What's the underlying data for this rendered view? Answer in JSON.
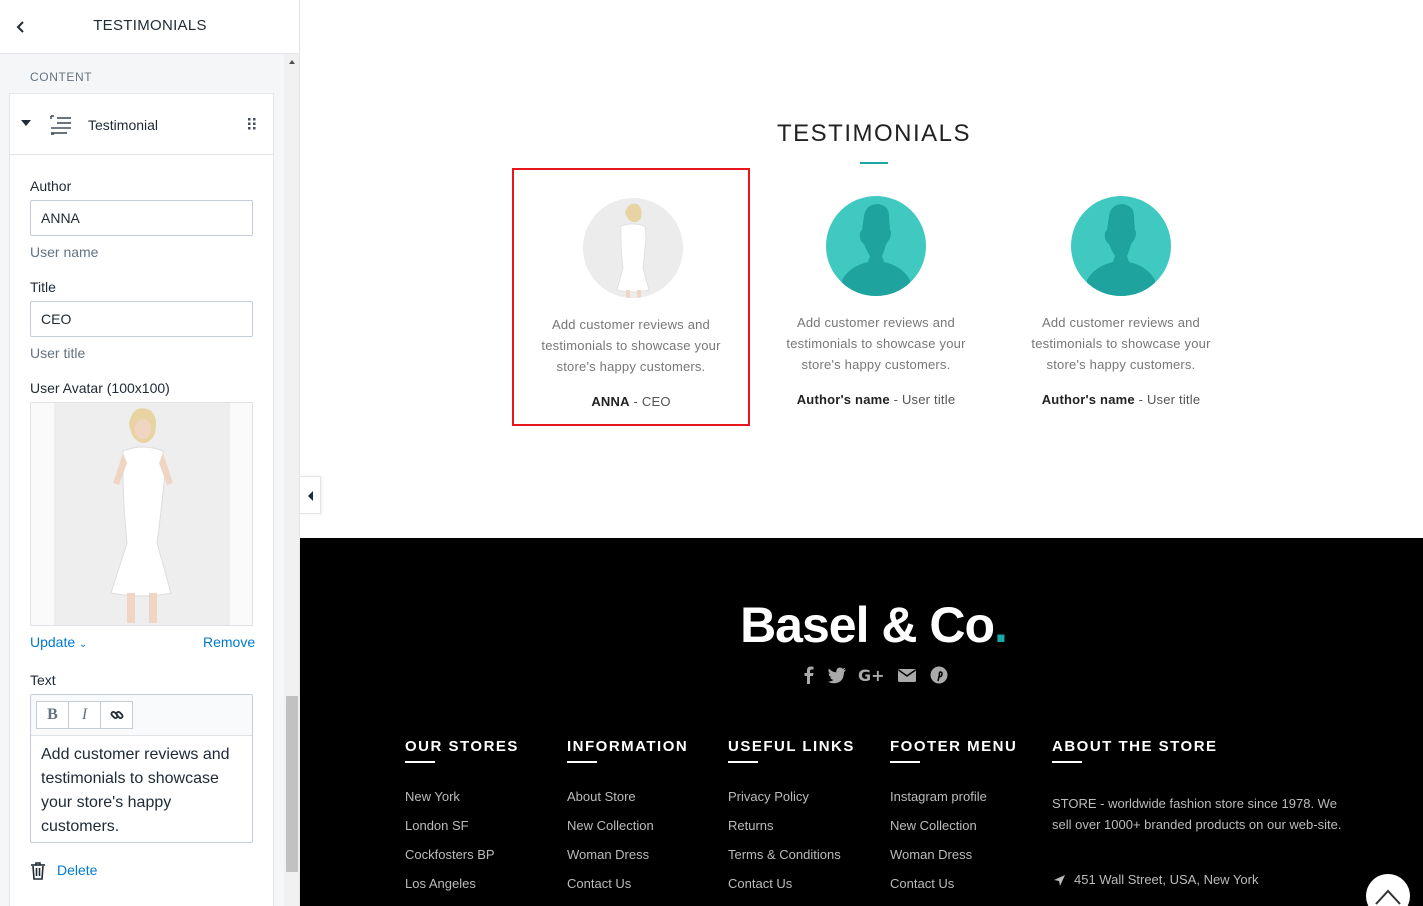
{
  "sidebar": {
    "header_title": "TESTIMONIALS",
    "section_label": "CONTENT",
    "block": {
      "label": "Testimonial",
      "author": {
        "label": "Author",
        "value": "ANNA",
        "help": "User name"
      },
      "title": {
        "label": "Title",
        "value": "CEO",
        "help": "User title"
      },
      "avatar": {
        "label": "User Avatar (100x100)",
        "update_label": "Update",
        "remove_label": "Remove"
      },
      "text": {
        "label": "Text",
        "toolbar": {
          "bold": "B",
          "italic": "I"
        },
        "value": "Add customer reviews and testimonials to showcase your store's happy customers."
      },
      "delete_label": "Delete"
    }
  },
  "preview": {
    "section_title": "TESTIMONIALS",
    "testimonials": [
      {
        "text": "Add customer reviews and testimonials to showcase your store's happy customers.",
        "author": "ANNA",
        "separator": " - ",
        "title": "CEO"
      },
      {
        "text": "Add customer reviews and testimonials to showcase your store's happy customers.",
        "author": "Author's name",
        "separator": " - ",
        "title": "User title"
      },
      {
        "text": "Add customer reviews and testimonials to showcase your store's happy customers.",
        "author": "Author's name",
        "separator": " - ",
        "title": "User title"
      }
    ],
    "footer": {
      "logo_text": "Basel & Co",
      "logo_dot": ".",
      "social_icons": [
        "facebook-icon",
        "twitter-icon",
        "google-plus-icon",
        "email-icon",
        "pinterest-icon"
      ],
      "columns": [
        {
          "title": "OUR STORES",
          "links": [
            "New York",
            "London SF",
            "Cockfosters BP",
            "Los Angeles"
          ]
        },
        {
          "title": "INFORMATION",
          "links": [
            "About Store",
            "New Collection",
            "Woman Dress",
            "Contact Us"
          ]
        },
        {
          "title": "USEFUL LINKS",
          "links": [
            "Privacy Policy",
            "Returns",
            "Terms & Conditions",
            "Contact Us"
          ]
        },
        {
          "title": "FOOTER MENU",
          "links": [
            "Instagram profile",
            "New Collection",
            "Woman Dress",
            "Contact Us"
          ]
        }
      ],
      "about": {
        "title": "ABOUT THE STORE",
        "text": "STORE - worldwide fashion store since 1978. We sell over 1000+ branded products on our web-site.",
        "address": "451 Wall Street, USA, New York"
      }
    }
  },
  "colors": {
    "accent": "#1aa7a7",
    "selection": "#e8151b",
    "link": "#007ace",
    "avatar_bg": "#3fc9c0"
  }
}
